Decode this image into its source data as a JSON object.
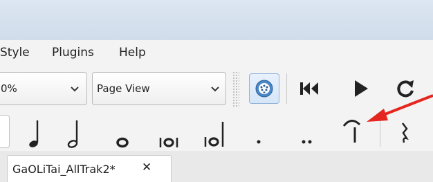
{
  "menu": {
    "style": "Style",
    "plugins": "Plugins",
    "help": "Help"
  },
  "toolbar": {
    "zoom_value": "0%",
    "view_mode": "Page View",
    "icons": [
      "midi-input-icon",
      "rewind-icon",
      "play-icon",
      "loop-icon"
    ]
  },
  "note_input": {
    "icons": [
      "quarter-note-icon",
      "half-note-icon",
      "whole-note-icon",
      "breve-note-icon",
      "longa-note-icon",
      "augmentation-dot-icon",
      "double-augmentation-dot-icon",
      "tie-icon",
      "rest-icon"
    ]
  },
  "tabs": [
    {
      "label": "GaOLiTai_AllTrak2*",
      "close": "✕"
    }
  ],
  "annotation": {
    "arrow_color": "#e5261f"
  }
}
